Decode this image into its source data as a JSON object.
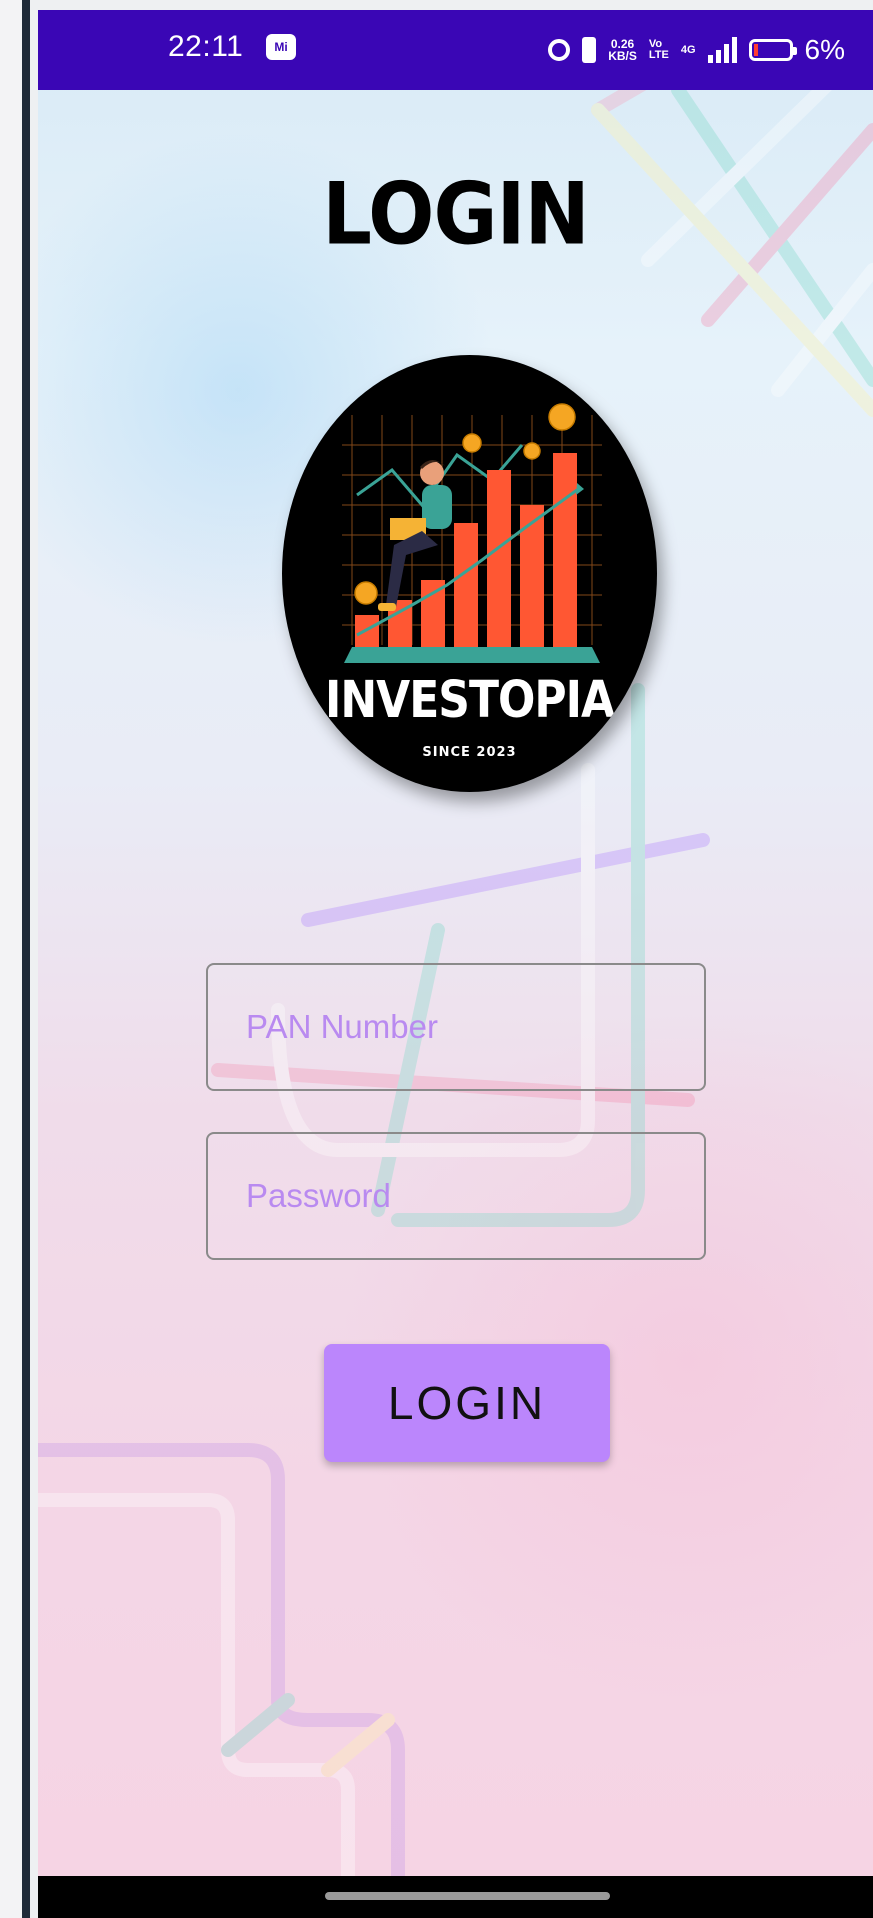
{
  "status_bar": {
    "time": "22:11",
    "app_icon": "Mi",
    "net_speed_value": "0.26",
    "net_speed_unit": "KB/S",
    "volte_top": "Vo",
    "volte_bottom": "LTE",
    "network_type": "4G",
    "battery_percent": "6%"
  },
  "page": {
    "title": "LOGIN"
  },
  "logo": {
    "name": "INVESTOPIA",
    "since": "SINCE 2023"
  },
  "form": {
    "pan_placeholder": "PAN Number",
    "password_placeholder": "Password",
    "login_label": "LOGIN"
  },
  "colors": {
    "status_bar": "#3a06b5",
    "button": "#bb86fc",
    "placeholder": "#b98af0",
    "chart_bar": "#ff5733",
    "stage": "#3aa396"
  }
}
